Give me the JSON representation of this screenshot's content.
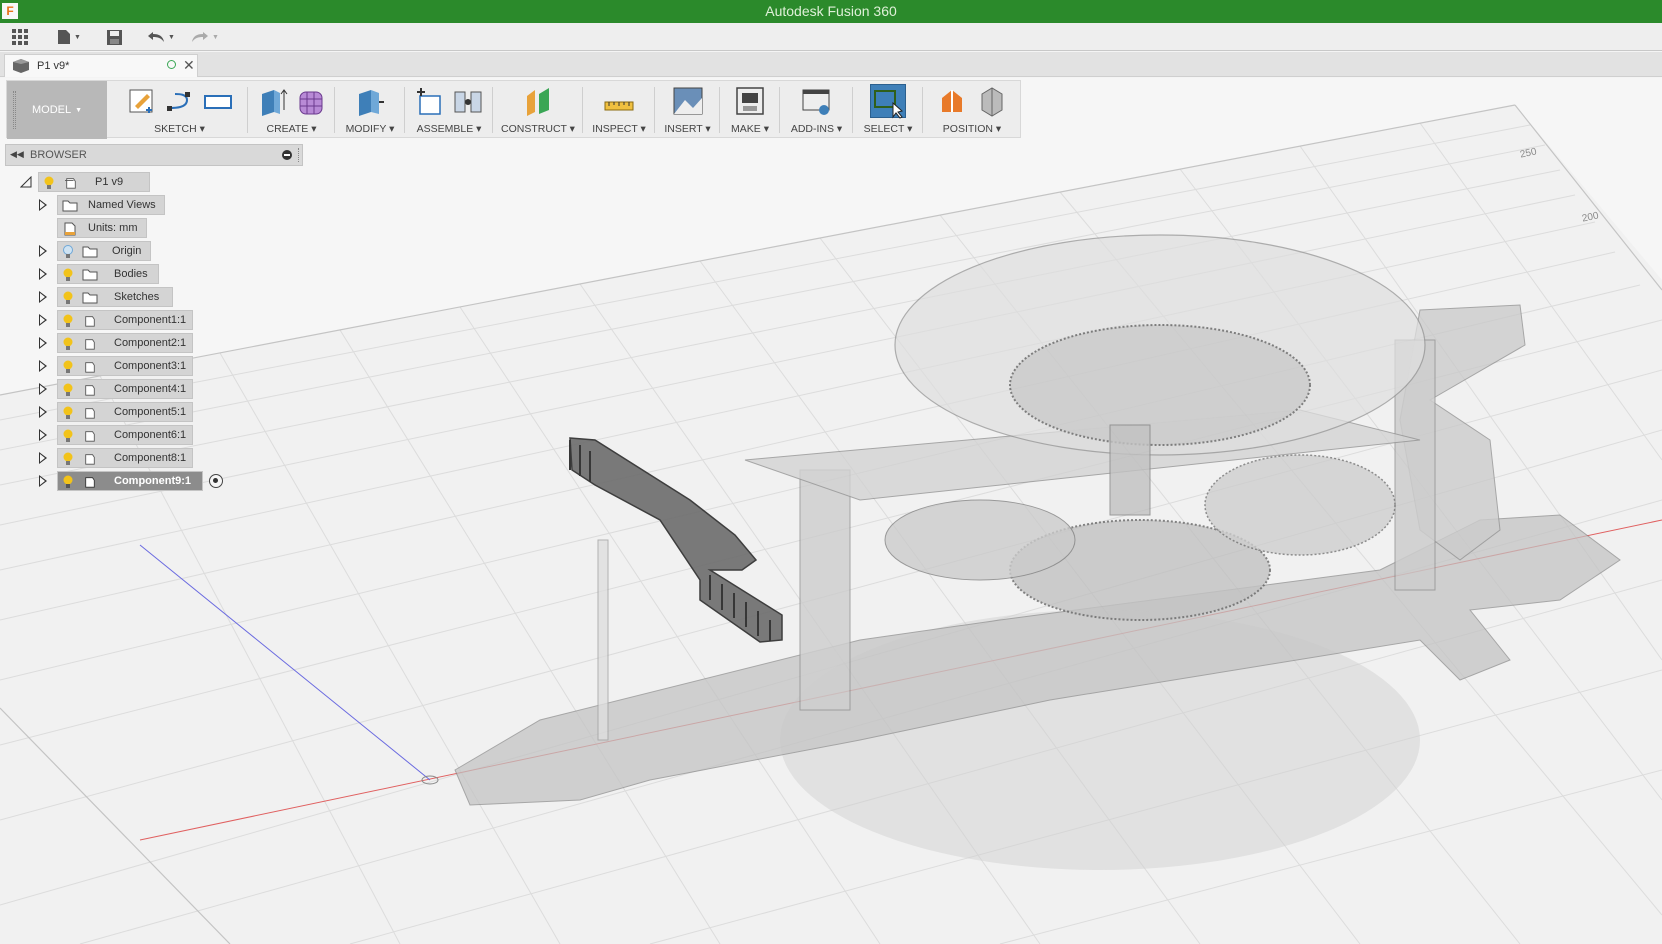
{
  "title_bar": {
    "title": "Autodesk Fusion 360",
    "app_icon_letter": "F"
  },
  "document_tab": {
    "name": "P1 v9*"
  },
  "toolbar": {
    "workspace": "MODEL",
    "groups": [
      {
        "label": "SKETCH"
      },
      {
        "label": "CREATE"
      },
      {
        "label": "MODIFY"
      },
      {
        "label": "ASSEMBLE"
      },
      {
        "label": "CONSTRUCT"
      },
      {
        "label": "INSPECT"
      },
      {
        "label": "INSERT"
      },
      {
        "label": "MAKE"
      },
      {
        "label": "ADD-INS"
      },
      {
        "label": "SELECT"
      },
      {
        "label": "POSITION"
      }
    ]
  },
  "browser": {
    "title": "BROWSER",
    "root": "P1 v9",
    "items": [
      {
        "label": "Named Views"
      },
      {
        "label": "Units: mm"
      },
      {
        "label": "Origin"
      },
      {
        "label": "Bodies"
      },
      {
        "label": "Sketches"
      },
      {
        "label": "Component1:1"
      },
      {
        "label": "Component2:1"
      },
      {
        "label": "Component3:1"
      },
      {
        "label": "Component4:1"
      },
      {
        "label": "Component5:1"
      },
      {
        "label": "Component6:1"
      },
      {
        "label": "Component8:1"
      },
      {
        "label": "Component9:1"
      }
    ]
  },
  "viewport": {
    "grid_labels": [
      "250",
      "200"
    ]
  },
  "colors": {
    "title_green": "#2b8a2b",
    "select_blue": "#3e7fb8",
    "axis_red": "#e06060",
    "axis_blue": "#6a6ae0"
  }
}
